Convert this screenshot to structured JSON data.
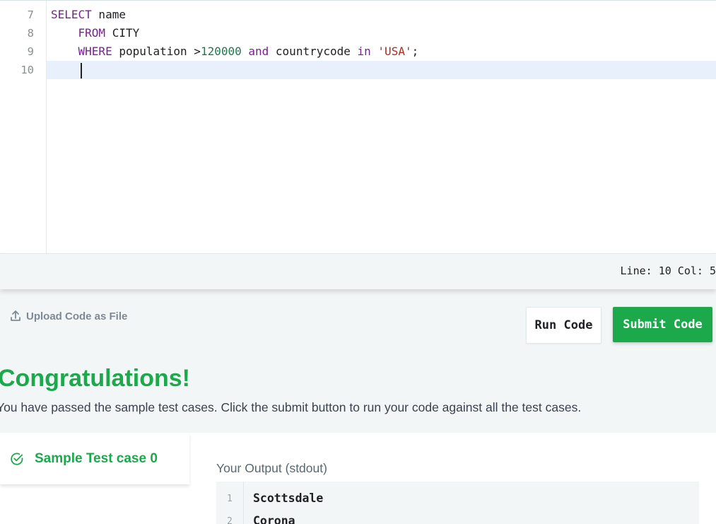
{
  "editor": {
    "line_numbers": [
      "7",
      "8",
      "9",
      "10"
    ],
    "lines": [
      [
        {
          "t": "SELECT",
          "c": "kw"
        },
        {
          "t": " name",
          "c": ""
        }
      ],
      [
        {
          "t": "    ",
          "c": ""
        },
        {
          "t": "FROM",
          "c": "kw"
        },
        {
          "t": " CITY",
          "c": ""
        }
      ],
      [
        {
          "t": "    ",
          "c": ""
        },
        {
          "t": "WHERE",
          "c": "kw"
        },
        {
          "t": " population >",
          "c": ""
        },
        {
          "t": "120000",
          "c": "num"
        },
        {
          "t": " ",
          "c": ""
        },
        {
          "t": "and",
          "c": "kw"
        },
        {
          "t": " countrycode ",
          "c": ""
        },
        {
          "t": "in",
          "c": "kw"
        },
        {
          "t": " ",
          "c": ""
        },
        {
          "t": "'USA'",
          "c": "str"
        },
        {
          "t": ";",
          "c": ""
        }
      ],
      [
        {
          "t": "    ",
          "c": ""
        }
      ]
    ]
  },
  "status": {
    "line_col": "Line: 10 Col: 5"
  },
  "actions": {
    "upload_label": "Upload Code as File",
    "run_label": "Run Code",
    "submit_label": "Submit Code"
  },
  "result": {
    "title": "Congratulations!",
    "message": "You have passed the sample test cases. Click the submit button to run your code against all the test cases."
  },
  "testcase": {
    "label": "Sample Test case 0"
  },
  "output": {
    "title": "Your Output (stdout)",
    "line_numbers": [
      "1",
      "2"
    ],
    "lines": [
      "Scottsdale",
      "Corona"
    ]
  },
  "colors": {
    "accent": "#1ba94c",
    "keyword": "#7a1f92",
    "number": "#1e7a4d",
    "string": "#b02a1c"
  }
}
